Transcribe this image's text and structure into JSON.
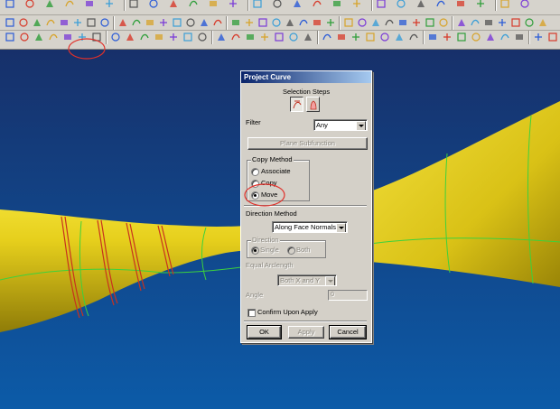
{
  "colors": {
    "viewport_top": "#17306a",
    "viewport_bottom": "#0c5ba8",
    "surface": "#e8d21e",
    "surface_shade": "#9e8a0a",
    "iso_lines": "#3cd23c",
    "curve_lines": "#c8321e",
    "annotation": "#e0302a"
  },
  "toolbar": {
    "row1_icons": [
      "new-icon",
      "open-icon",
      "save-icon",
      "cut-icon",
      "copy-icon",
      "paste-icon",
      "undo-icon",
      "redo-icon",
      "delete-icon",
      "point-icon",
      "arrow-icon",
      "box-icon",
      "grid-icon",
      "layer-icon",
      "view-fit-icon",
      "zoom-icon",
      "zoom-in-icon",
      "pan-icon",
      "rotate-icon",
      "sphere-icon",
      "render-icon",
      "light-icon",
      "dimension-icon",
      "cylinder-icon",
      "cone-icon",
      "torus-icon",
      "block-icon",
      "cut-icon",
      "union-icon",
      "revolve-icon",
      "extrude-icon",
      "sweep-icon",
      "through-curves-icon",
      "mesh-icon",
      "sew-icon",
      "trim-icon",
      "offset-icon",
      "blend-icon",
      "chamfer-icon",
      "shell-icon",
      "draft-icon",
      "measure-icon",
      "analysis-icon",
      "color-icon",
      "display-icon",
      "shade-icon",
      "wireframe-icon",
      "hide-icon",
      "show-icon",
      "filter-icon",
      "layout-icon",
      "help-icon"
    ],
    "row2_icons": [
      "point-icon",
      "line-icon",
      "arc-icon",
      "circle-icon",
      "spline-icon",
      "project-curve-icon",
      "intersect-icon",
      "offset-curve-icon",
      "bridge-icon",
      "fillet-curve-icon",
      "combine-icon",
      "wrap-icon",
      "extract-icon",
      "trim-curve-icon",
      "divide-icon",
      "edit-curve-icon",
      "stretch-icon",
      "smooth-icon",
      "join-icon",
      "helix-icon",
      "section-icon",
      "isoparametric-icon",
      "surface-icon",
      "ruled-icon",
      "sweep-icon",
      "through-mesh-icon",
      "blend-icon",
      "fill-icon",
      "offset-surface-icon",
      "trim-surface-icon",
      "extend-icon",
      "sew-icon",
      "shade-icon",
      "analysis-icon",
      "edit-icon",
      "mirror-icon",
      "delete-icon"
    ]
  },
  "dialog": {
    "title": "Project Curve",
    "selection_steps_label": "Selection Steps",
    "selection_steps": [
      {
        "icon": "curve-select-icon",
        "state": "active"
      },
      {
        "icon": "face-select-icon",
        "state": "idle"
      }
    ],
    "filter_label": "Filter",
    "filter_value": "Any",
    "plane_subfunction_label": "Plane Subfunction",
    "copy_method": {
      "legend": "Copy Method",
      "options": [
        "Associate",
        "Copy",
        "Move"
      ],
      "selected": "Move"
    },
    "direction_method_label": "Direction Method",
    "direction_method_value": "Along Face Normals",
    "direction": {
      "legend": "Direction",
      "options": [
        "Single",
        "Both"
      ],
      "selected": "Single"
    },
    "equal_arclength_label": "Equal Arclength",
    "equal_arclength_value": "Both X and Y",
    "angle_label": "Angle",
    "angle_value": "0",
    "confirm_label": "Confirm Upon Apply",
    "confirm_checked": false,
    "buttons": {
      "ok": "OK",
      "apply": "Apply",
      "cancel": "Cancel"
    }
  }
}
